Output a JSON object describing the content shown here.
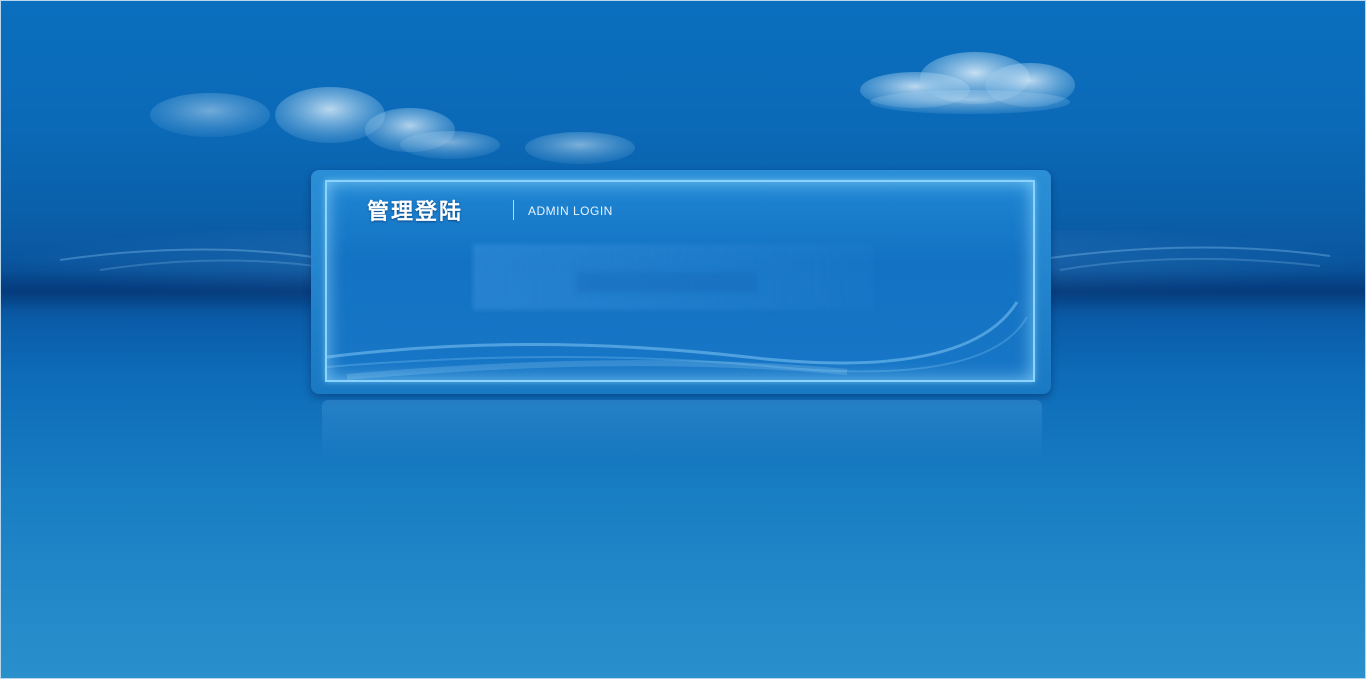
{
  "login_panel": {
    "title_cn": "管理登陆",
    "title_en": "ADMIN LOGIN"
  },
  "colors": {
    "background_top": "#0a6fbe",
    "background_bottom": "#2a90cc",
    "panel_border": "#8ad2ff",
    "text": "#ffffff"
  },
  "icons": [
    "cloud-left",
    "cloud-right"
  ]
}
